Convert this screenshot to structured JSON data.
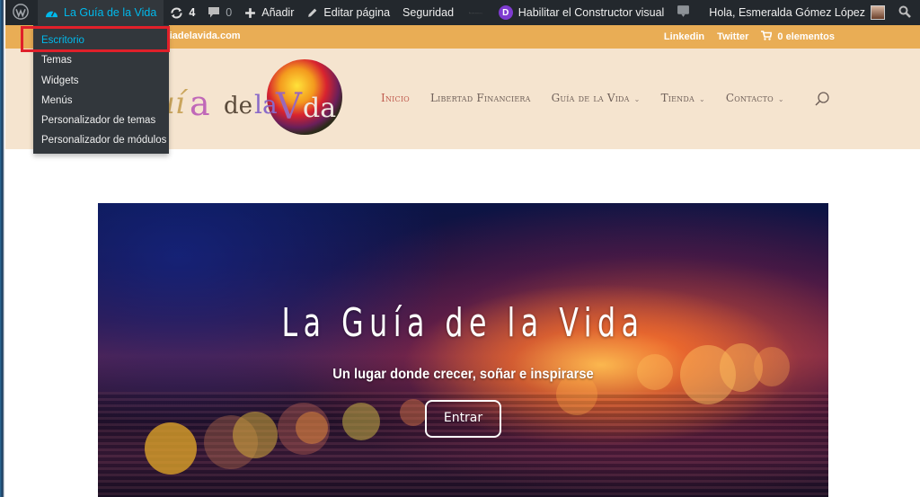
{
  "admin_bar": {
    "site_name": "La Guía de la Vida",
    "updates_count": "4",
    "comments_count": "0",
    "add_label": "Añadir",
    "edit_label": "Editar página",
    "security_label": "Seguridad",
    "divi_badge": "D",
    "visual_builder_label": "Habilitar el Constructor visual",
    "greeting": "Hola, Esmeralda Gómez López"
  },
  "site_menu": {
    "items": [
      {
        "label": "Escritorio",
        "active": true
      },
      {
        "label": "Temas"
      },
      {
        "label": "Widgets"
      },
      {
        "label": "Menús"
      },
      {
        "label": "Personalizador de temas"
      },
      {
        "label": "Personalizador de módulos"
      }
    ]
  },
  "top_bar": {
    "site_url_partial": "uiadelavida.com",
    "links": [
      "Linkedin",
      "Twitter"
    ],
    "cart_label": "0 elementos"
  },
  "header": {
    "logo_alt": "La Guía de la Vida",
    "nav": [
      {
        "label": "Inicio",
        "active": true,
        "has_submenu": false
      },
      {
        "label": "Libertad Financiera",
        "has_submenu": false
      },
      {
        "label": "Guía de la Vida",
        "has_submenu": true
      },
      {
        "label": "Tienda",
        "has_submenu": true
      },
      {
        "label": "Contacto",
        "has_submenu": true
      }
    ]
  },
  "hero": {
    "title": "La Guía de la Vida",
    "subtitle": "Un lugar donde crecer, soñar e inspirarse",
    "button_label": "Entrar"
  },
  "colors": {
    "admin_bar_bg": "#23282d",
    "admin_link_active": "#00b9eb",
    "top_bar_bg": "#e9ad55",
    "header_bg": "#f5e4cf",
    "nav_active": "#c05b4f",
    "highlight_border": "#e0202a",
    "divi_purple": "#7e3bd0"
  }
}
